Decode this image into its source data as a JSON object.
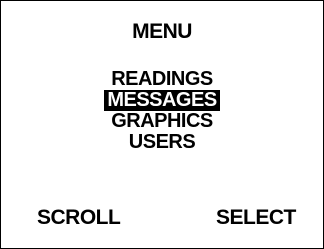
{
  "screen": {
    "title": "MENU"
  },
  "menu": {
    "items": [
      {
        "label": "READINGS",
        "selected": false
      },
      {
        "label": "MESSAGES",
        "selected": true
      },
      {
        "label": "GRAPHICS",
        "selected": false
      },
      {
        "label": "USERS",
        "selected": false
      }
    ]
  },
  "softkeys": {
    "left_label": "SCROLL",
    "right_label": "SELECT"
  },
  "colors": {
    "foreground": "#000000",
    "background": "#ffffff",
    "highlight_bg": "#000000",
    "highlight_fg": "#ffffff"
  }
}
